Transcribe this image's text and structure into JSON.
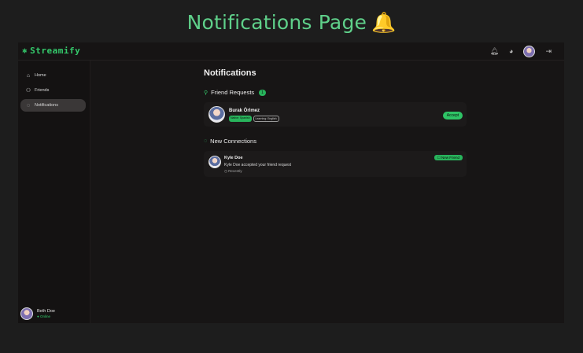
{
  "caption": {
    "title": "Notifications Page",
    "emoji": "🔔"
  },
  "app": {
    "brand": "Streamify",
    "logo_icon": "ship-wheel-icon"
  },
  "topbar": {
    "icons": [
      "bell-icon",
      "palette-icon",
      "user-avatar",
      "logout-icon"
    ]
  },
  "sidebar": {
    "items": [
      {
        "label": "Home",
        "icon": "home-icon"
      },
      {
        "label": "Friends",
        "icon": "users-icon"
      },
      {
        "label": "Notifications",
        "icon": "bell-icon",
        "active": true
      }
    ],
    "user": {
      "name": "Beth Doe",
      "status": "● Online"
    }
  },
  "main": {
    "title": "Notifications",
    "friend_requests": {
      "heading": "Friend Requests",
      "count": "1",
      "items": [
        {
          "name": "Burak Örlmez",
          "native": "Native: Spanish",
          "learning": "Learning: English",
          "accept": "Accept"
        }
      ]
    },
    "new_connections": {
      "heading": "New Connections",
      "items": [
        {
          "name": "Kyle Doe",
          "message": "Kyle Doe accepted your friend request",
          "time": "◷ Recently",
          "badge": "☐ New Friend"
        }
      ]
    }
  },
  "colors": {
    "accent": "#34c96b",
    "background": "#171515",
    "caption": "#5fd08a"
  }
}
